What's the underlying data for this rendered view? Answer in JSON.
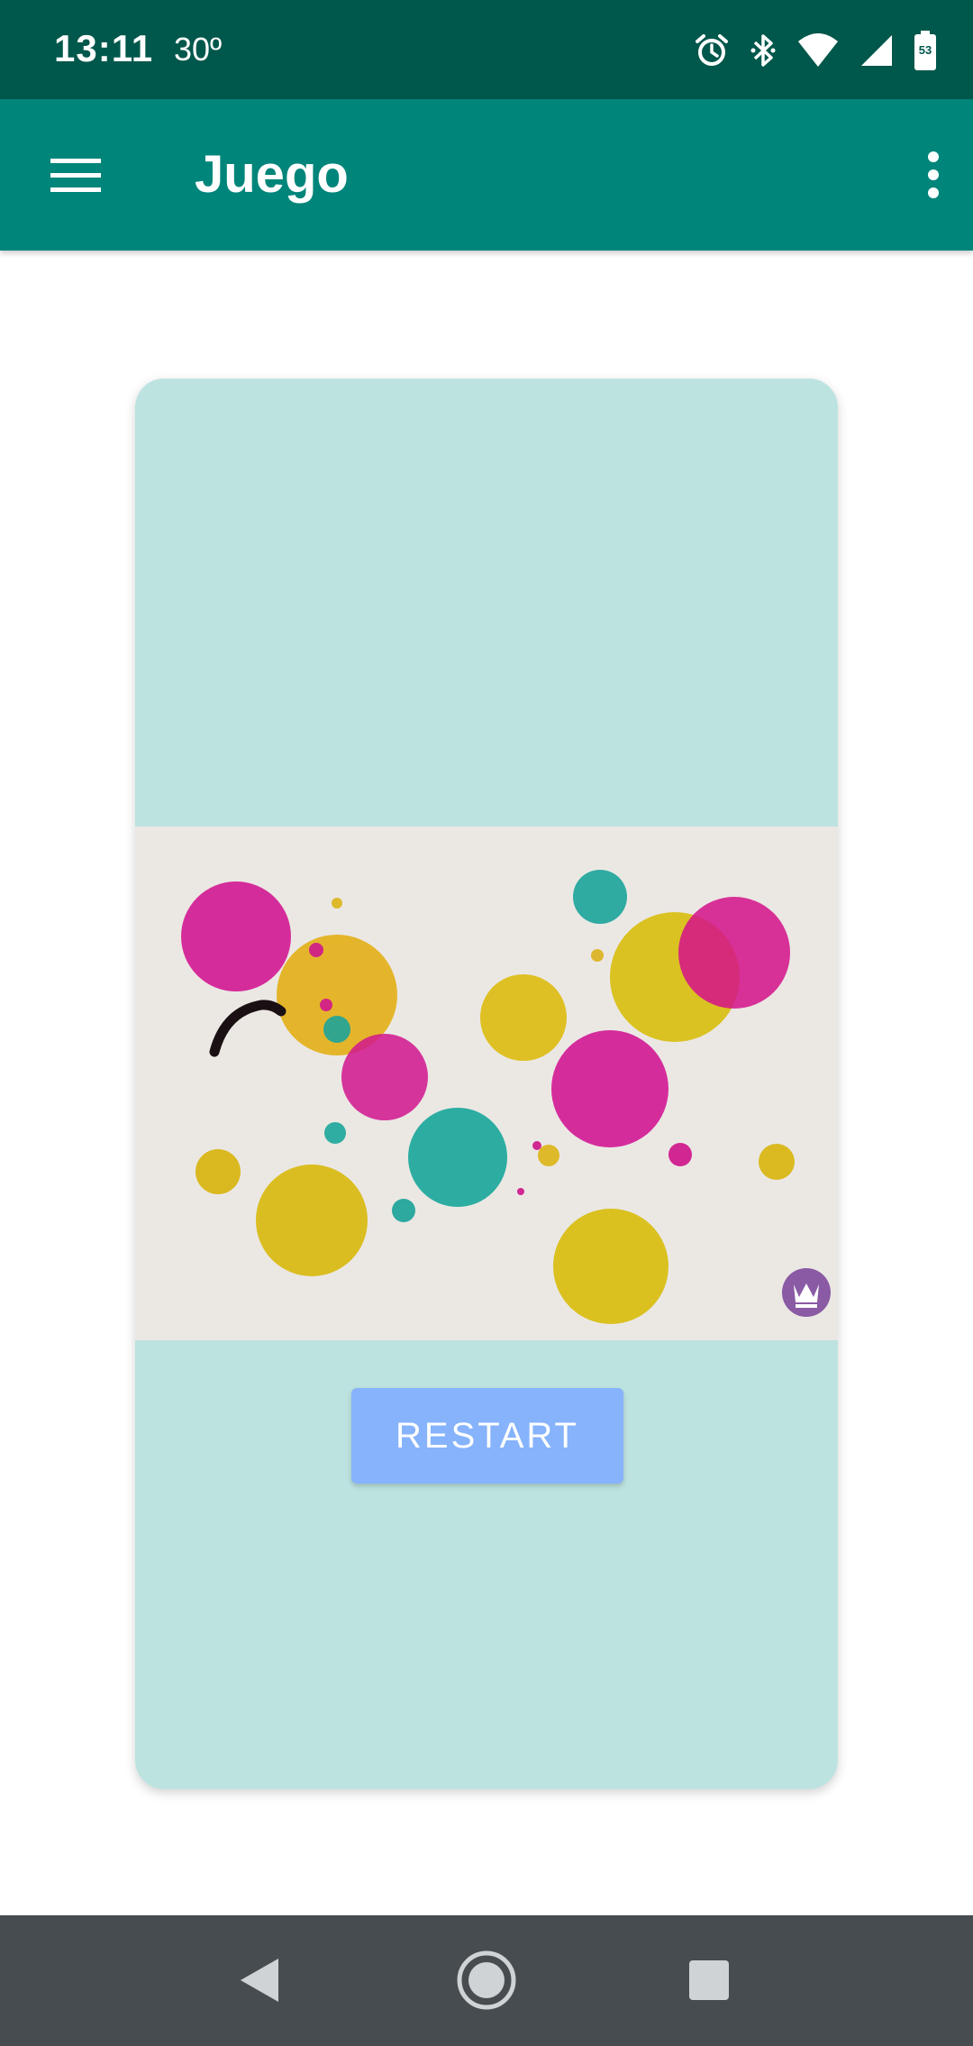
{
  "status_bar": {
    "time": "13:11",
    "temperature": "30º",
    "icons": [
      "alarm-icon",
      "bluetooth-icon",
      "wifi-icon",
      "signal-icon",
      "battery-icon"
    ],
    "battery_level": "53"
  },
  "app_bar": {
    "title": "Juego",
    "menu_icon": "hamburger-menu-icon",
    "overflow_icon": "more-vert-icon",
    "background": "#00857a"
  },
  "game_card": {
    "background": "#bde3e0",
    "image_description_icons": [
      "painting-image",
      "crown-badge-icon"
    ],
    "restart_label": "RESTART",
    "restart_color": "#86b3fb"
  },
  "nav_bar": {
    "icons": [
      "back-icon",
      "home-icon",
      "recents-icon"
    ]
  }
}
